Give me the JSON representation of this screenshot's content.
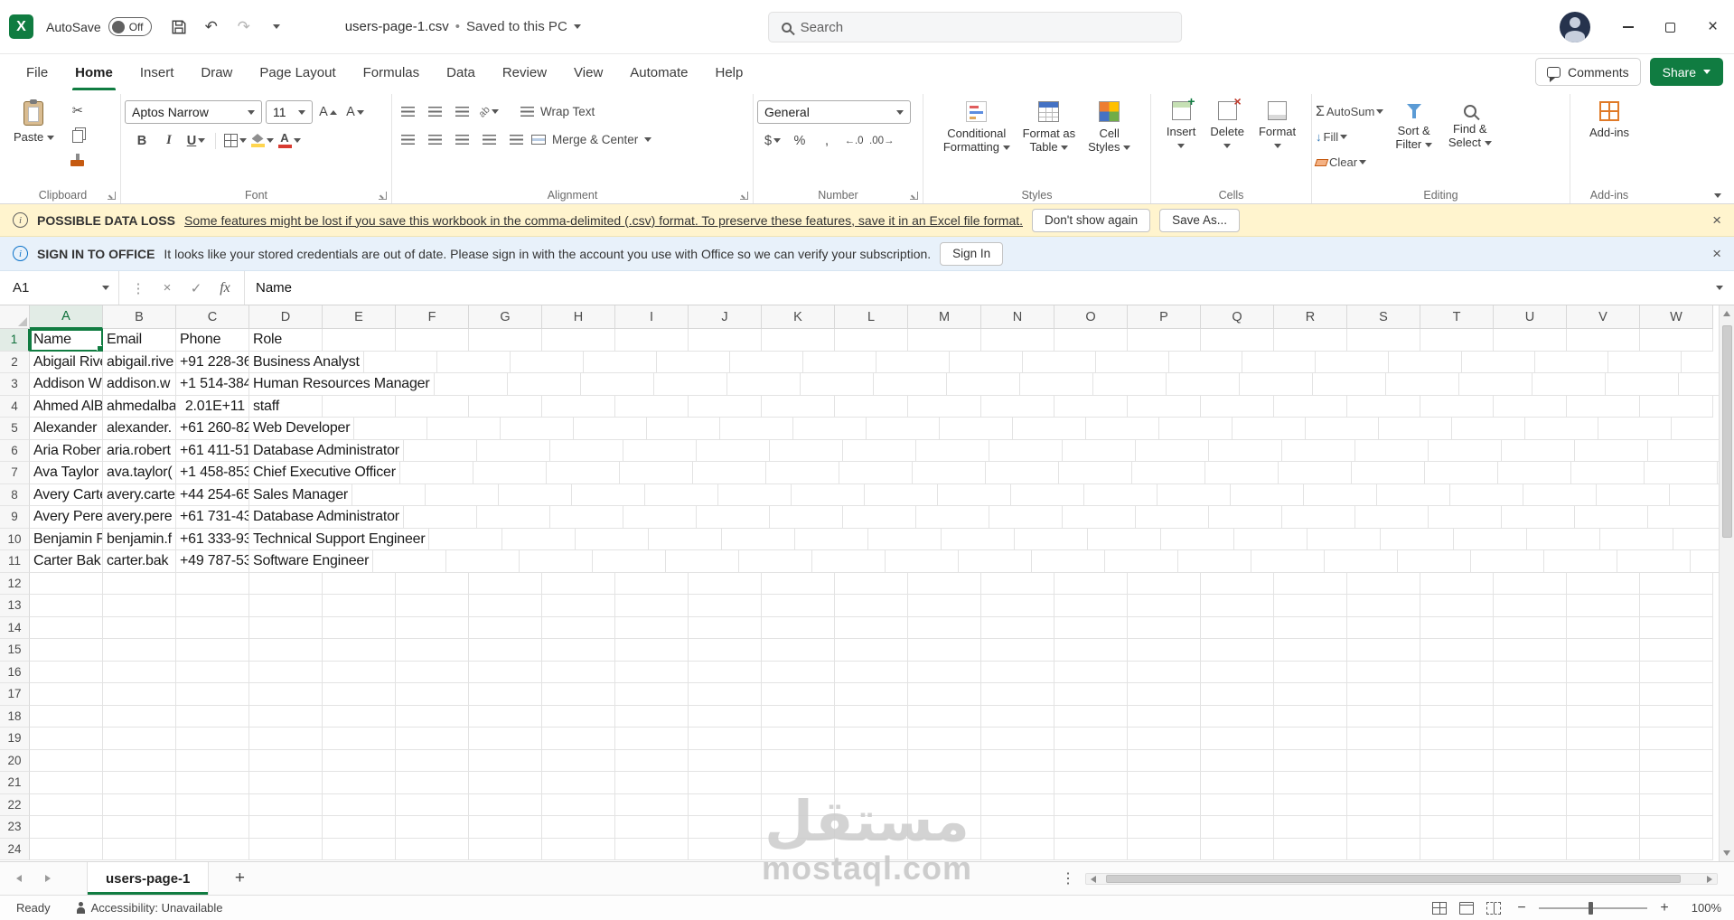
{
  "glyphs": {
    "excel_logo": "X",
    "undo": "↶",
    "redo": "↷",
    "close": "×",
    "minimize_desc": "minimize",
    "cut": "✂",
    "bold": "B",
    "italic": "I",
    "underline": "U",
    "font_color_letter": "A",
    "grow_font_letter": "A",
    "shrink_font_letter": "A",
    "orientation": "ab",
    "currency": "$",
    "percent": "%",
    "comma": ",",
    "inc_decimal": "←.0",
    "dec_decimal": ".00→",
    "autosum_sigma": "Σ",
    "fill_arrow": "↓",
    "cancel": "×",
    "check": "✓",
    "fx": "fx",
    "dots_v": "⋮",
    "plus": "+",
    "insert_mark": "+",
    "delete_mark": "×",
    "minus": "−",
    "info": "i"
  },
  "titlebar": {
    "autosave_label": "AutoSave",
    "autosave_state": "Off",
    "doc_title": "users-page-1.csv",
    "separator": "•",
    "doc_status": "Saved to this PC",
    "search_placeholder": "Search"
  },
  "menu_tabs": [
    "File",
    "Home",
    "Insert",
    "Draw",
    "Page Layout",
    "Formulas",
    "Data",
    "Review",
    "View",
    "Automate",
    "Help"
  ],
  "active_tab": "Home",
  "tabrow_right": {
    "comments": "Comments",
    "share": "Share"
  },
  "ribbon": {
    "clipboard": {
      "group": "Clipboard",
      "paste": "Paste"
    },
    "font": {
      "group": "Font",
      "font_name": "Aptos Narrow",
      "font_size": "11"
    },
    "alignment": {
      "group": "Alignment",
      "wrap_text": "Wrap Text",
      "merge_center": "Merge & Center"
    },
    "number": {
      "group": "Number",
      "format": "General"
    },
    "styles": {
      "group": "Styles",
      "conditional": "Conditional\nFormatting",
      "format_table": "Format as\nTable",
      "cell_styles": "Cell\nStyles"
    },
    "cells": {
      "group": "Cells",
      "insert": "Insert",
      "delete": "Delete",
      "format": "Format"
    },
    "editing": {
      "group": "Editing",
      "autosum": "AutoSum",
      "fill": "Fill",
      "clear": "Clear",
      "sort_filter": "Sort &\nFilter",
      "find_select": "Find &\nSelect"
    },
    "addins": {
      "group": "Add-ins",
      "addins": "Add-ins"
    }
  },
  "notifications": [
    {
      "id": "possible-data-loss",
      "title": "POSSIBLE DATA LOSS",
      "message": "Some features might be lost if you save this workbook in the comma-delimited (.csv) format. To preserve these features, save it in an Excel file format.",
      "buttons": [
        "Don't show again",
        "Save As..."
      ]
    },
    {
      "id": "sign-in-to-office",
      "title": "SIGN IN TO OFFICE",
      "message": "It looks like your stored credentials are out of date. Please sign in with the account you use with Office so we can verify your subscription.",
      "buttons": [
        "Sign In"
      ]
    }
  ],
  "formula_bar": {
    "name_box": "A1",
    "content": "Name"
  },
  "grid": {
    "columns": [
      "A",
      "B",
      "C",
      "D",
      "E",
      "F",
      "G",
      "H",
      "I",
      "J",
      "K",
      "L",
      "M",
      "N",
      "O",
      "P",
      "Q",
      "R",
      "S",
      "T",
      "U",
      "V",
      "W"
    ],
    "row_count": 24,
    "selected_cell": "A1",
    "right_aligned": [
      "C4"
    ],
    "rows": [
      [
        "Name",
        "Email",
        "Phone",
        "Role"
      ],
      [
        "Abigail Rive",
        "abigail.rive",
        "+91 228-36",
        "Business Analyst"
      ],
      [
        "Addison W",
        "addison.w",
        "+1 514-384",
        "Human Resources Manager"
      ],
      [
        "Ahmed AlB",
        "ahmedalba",
        "2.01E+11",
        "staff"
      ],
      [
        "Alexander",
        "alexander.",
        "+61 260-82",
        "Web Developer"
      ],
      [
        "Aria Rober",
        "aria.robert",
        "+61 411-51",
        "Database Administrator"
      ],
      [
        "Ava Taylor",
        "ava.taylor(",
        "+1 458-853",
        "Chief Executive Officer"
      ],
      [
        "Avery Carte",
        "avery.carte",
        "+44 254-65",
        "Sales Manager"
      ],
      [
        "Avery Pere",
        "avery.pere",
        "+61 731-43",
        "Database Administrator"
      ],
      [
        "Benjamin F",
        "benjamin.f",
        "+61 333-93",
        "Technical Support Engineer"
      ],
      [
        "Carter Bak",
        "carter.bak",
        "+49 787-53",
        "Software Engineer"
      ]
    ]
  },
  "sheet_tabs": {
    "tabs": [
      "users-page-1"
    ],
    "active": "users-page-1"
  },
  "status_bar": {
    "ready": "Ready",
    "accessibility": "Accessibility: Unavailable",
    "zoom": "100%"
  },
  "watermark": {
    "arabic": "مستقل",
    "latin": "mostaql.com"
  },
  "colors": {
    "accent_green": "#107C41",
    "warning_bg": "#FFF4CE",
    "info_bg": "#E8F1FA",
    "selection": "#107C41"
  }
}
